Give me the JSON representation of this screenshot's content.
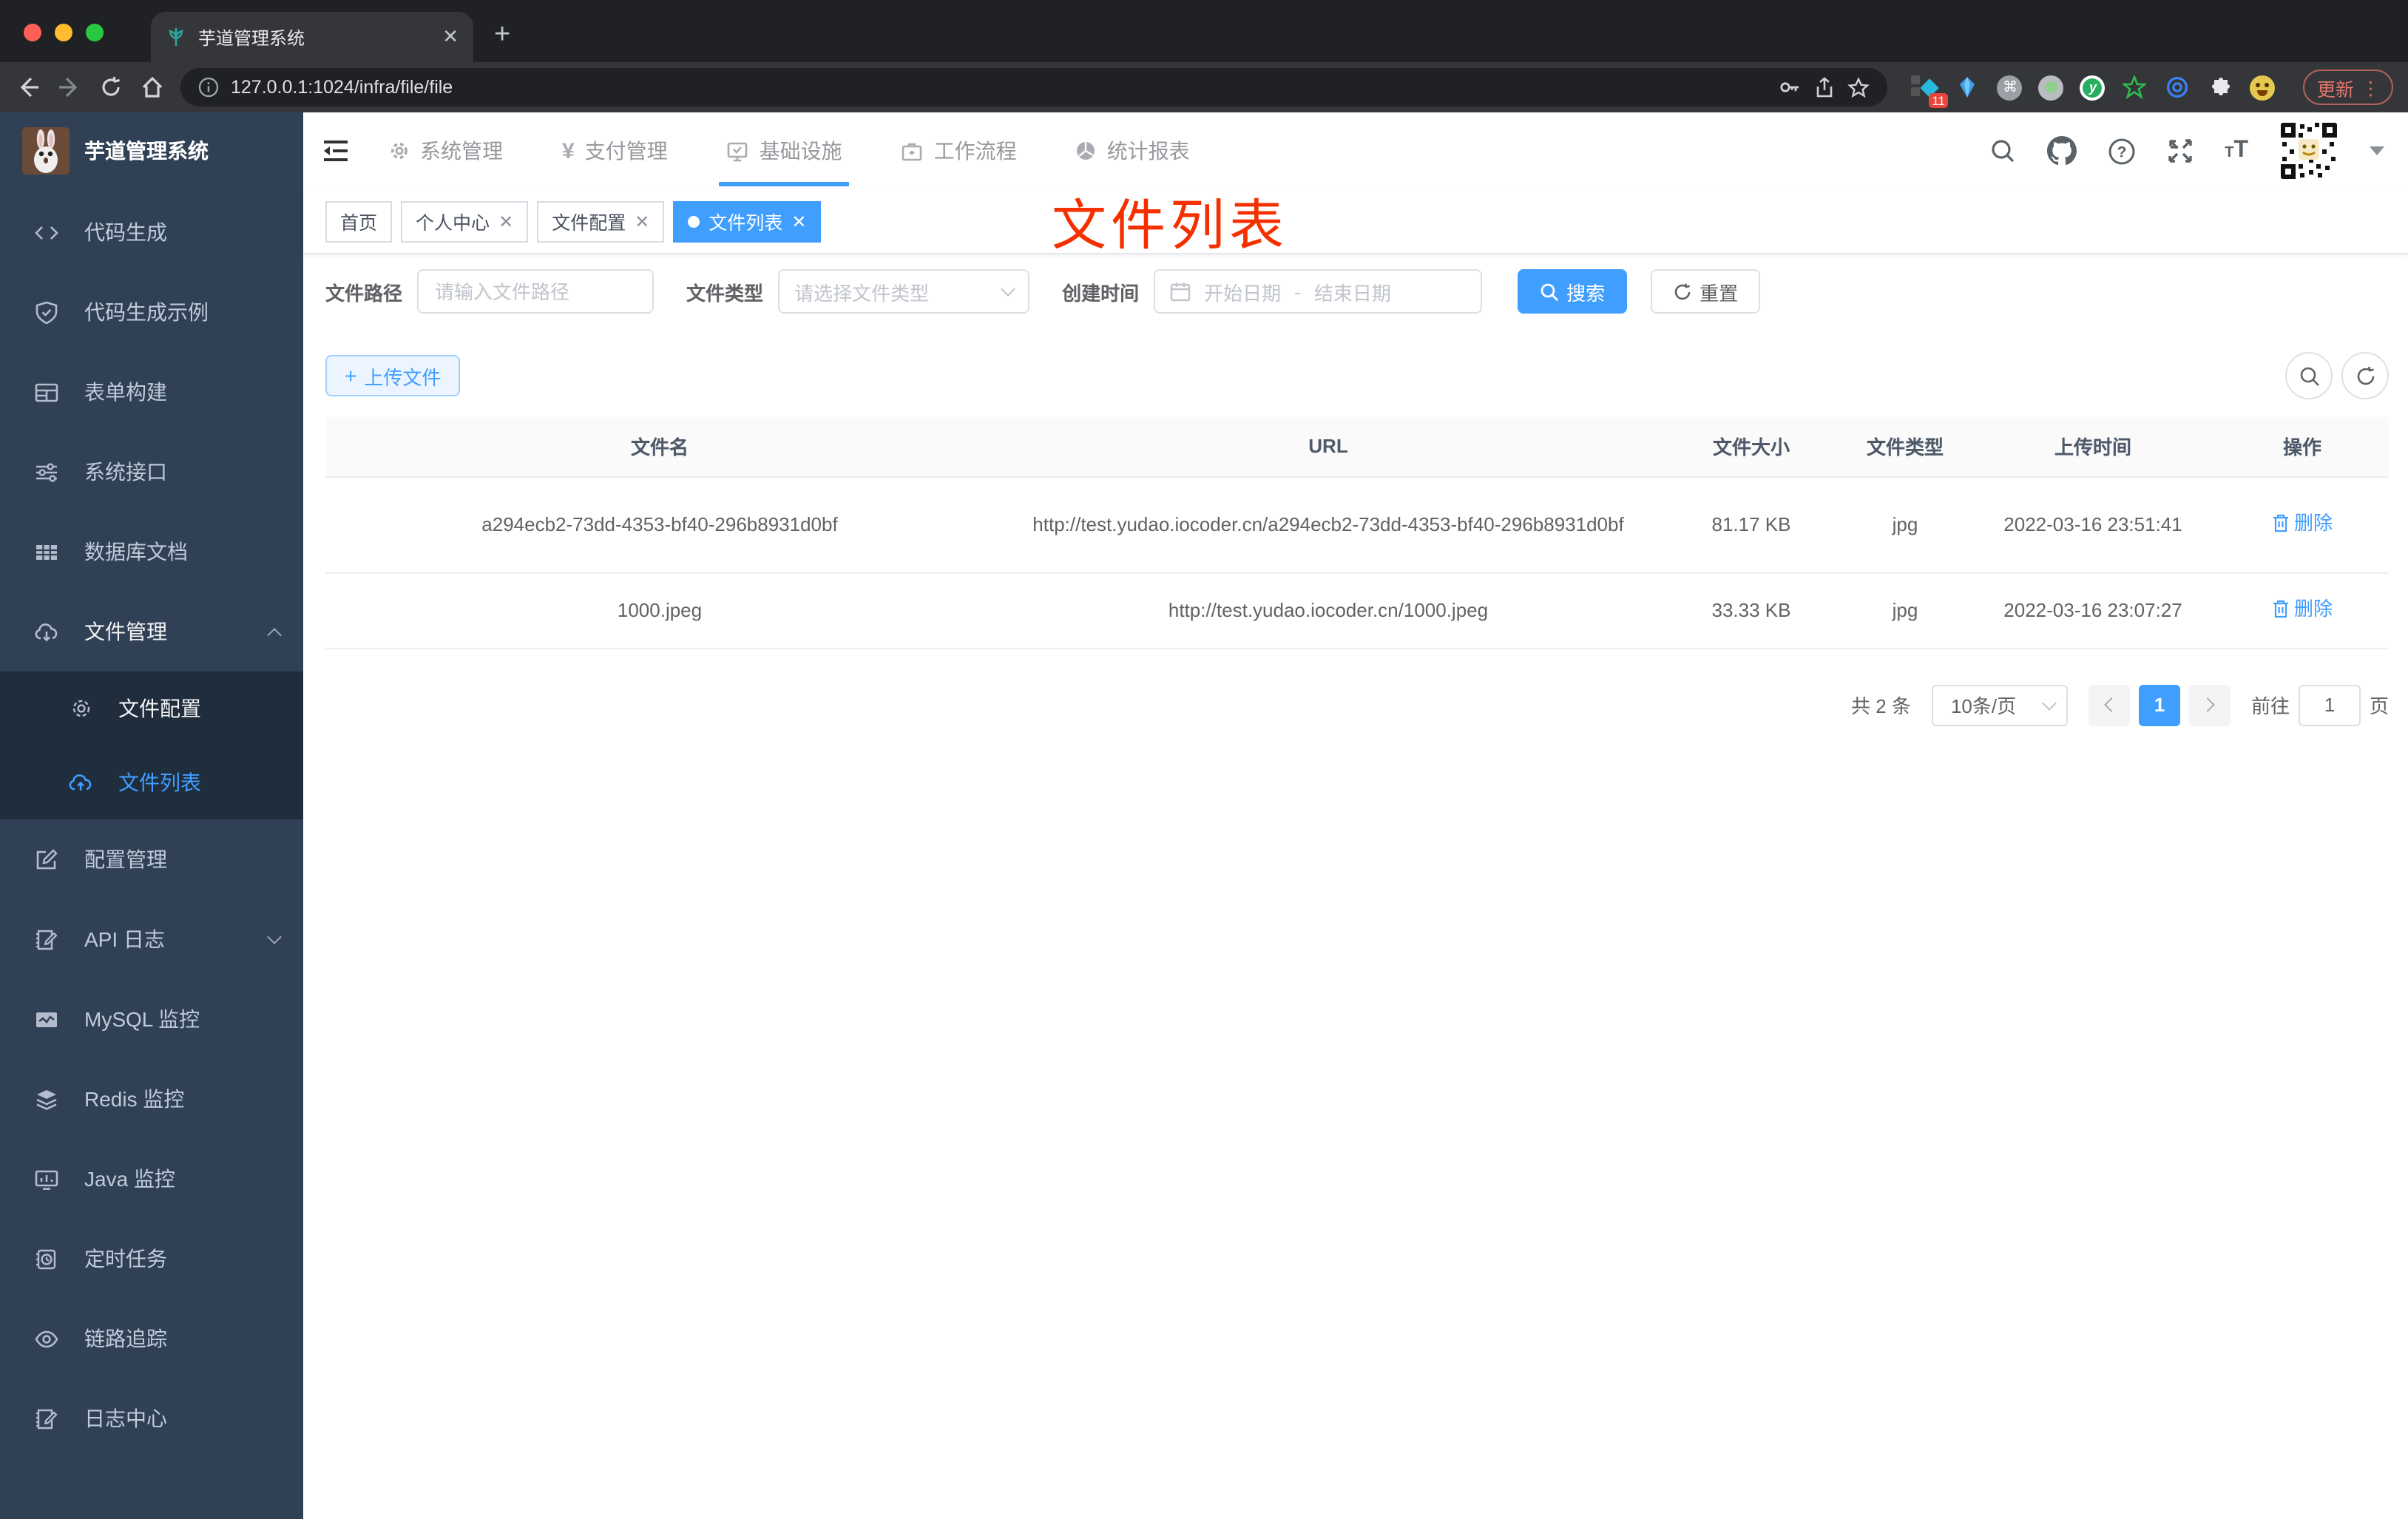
{
  "colors": {
    "accent": "#409EFF",
    "annotation_red": "#f53000",
    "sidebar_bg": "#304156",
    "submenu_bg": "#1f2d3d"
  },
  "browser": {
    "tab_title": "芋道管理系统",
    "url": "127.0.0.1:1024/infra/file/file",
    "extension_badge": "11",
    "update_label": "更新"
  },
  "sidebar": {
    "logo_title": "芋道管理系统",
    "items": [
      {
        "label": "代码生成"
      },
      {
        "label": "代码生成示例"
      },
      {
        "label": "表单构建"
      },
      {
        "label": "系统接口"
      },
      {
        "label": "数据库文档"
      },
      {
        "label": "文件管理",
        "expanded": true,
        "children": [
          {
            "label": "文件配置"
          },
          {
            "label": "文件列表",
            "active": true
          }
        ]
      },
      {
        "label": "配置管理"
      },
      {
        "label": "API 日志",
        "collapsed": true
      },
      {
        "label": "MySQL 监控"
      },
      {
        "label": "Redis 监控"
      },
      {
        "label": "Java 监控"
      },
      {
        "label": "定时任务"
      },
      {
        "label": "链路追踪"
      },
      {
        "label": "日志中心"
      }
    ]
  },
  "header": {
    "nav": [
      {
        "label": "系统管理"
      },
      {
        "label": "支付管理"
      },
      {
        "label": "基础设施",
        "active": true
      },
      {
        "label": "工作流程"
      },
      {
        "label": "统计报表"
      }
    ]
  },
  "tags": [
    {
      "label": "首页",
      "closable": false
    },
    {
      "label": "个人中心",
      "closable": true
    },
    {
      "label": "文件配置",
      "closable": true
    },
    {
      "label": "文件列表",
      "closable": true,
      "active": true
    }
  ],
  "annotation": "文件列表",
  "filters": {
    "path_label": "文件路径",
    "path_placeholder": "请输入文件路径",
    "type_label": "文件类型",
    "type_placeholder": "请选择文件类型",
    "date_label": "创建时间",
    "date_start_placeholder": "开始日期",
    "date_separator": "-",
    "date_end_placeholder": "结束日期",
    "search_label": "搜索",
    "reset_label": "重置"
  },
  "toolbar": {
    "upload_label": "上传文件"
  },
  "table": {
    "headers": [
      "文件名",
      "URL",
      "文件大小",
      "文件类型",
      "上传时间",
      "操作"
    ],
    "delete_label": "删除",
    "rows": [
      {
        "name": "a294ecb2-73dd-4353-bf40-296b8931d0bf",
        "url": "http://test.yudao.iocoder.cn/a294ecb2-73dd-4353-bf40-296b8931d0bf",
        "size": "81.17 KB",
        "type": "jpg",
        "time": "2022-03-16 23:51:41"
      },
      {
        "name": "1000.jpeg",
        "url": "http://test.yudao.iocoder.cn/1000.jpeg",
        "size": "33.33 KB",
        "type": "jpg",
        "time": "2022-03-16 23:07:27"
      }
    ]
  },
  "pagination": {
    "total_text": "共 2 条",
    "page_size": "10条/页",
    "current_page": "1",
    "goto_prefix": "前往",
    "goto_value": "1",
    "goto_suffix": "页"
  }
}
